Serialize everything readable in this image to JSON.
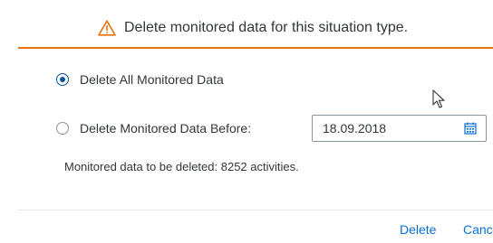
{
  "header": {
    "title": "Delete monitored data for this situation type.",
    "icon": "warning-icon",
    "accent_color": "#e9730c"
  },
  "options": {
    "all_label": "Delete All Monitored Data",
    "all_checked": true,
    "before_label": "Delete Monitored Data Before:",
    "before_checked": false
  },
  "date_field": {
    "value": "18.09.2018",
    "icon": "calendar-icon"
  },
  "info": {
    "text": "Monitored data to be deleted: 8252 activities."
  },
  "footer": {
    "delete_label": "Delete",
    "cancel_label": "Canc",
    "link_color": "#0a6ed1"
  }
}
